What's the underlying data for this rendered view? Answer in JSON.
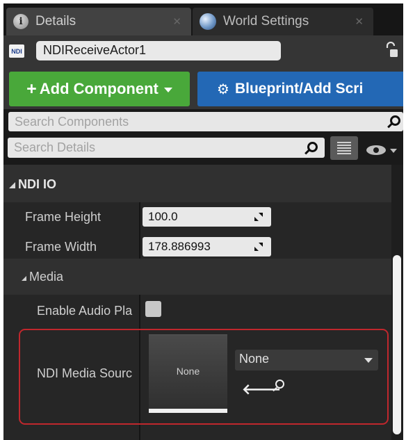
{
  "tabs": [
    {
      "label": "Details",
      "icon": "info-icon",
      "active": true
    },
    {
      "label": "World Settings",
      "icon": "globe-icon",
      "active": false
    }
  ],
  "actor": {
    "name": "NDIReceiveActor1",
    "logo_text": "NDI"
  },
  "buttons": {
    "add_component": "Add Component",
    "blueprint": "Blueprint/Add Scri"
  },
  "search": {
    "components_placeholder": "Search Components",
    "details_placeholder": "Search Details"
  },
  "category": {
    "label": "NDI IO"
  },
  "properties": {
    "frame_height": {
      "label": "Frame Height",
      "value": "100.0"
    },
    "frame_width": {
      "label": "Frame Width",
      "value": "178.886993"
    }
  },
  "media": {
    "label": "Media",
    "enable_audio": {
      "label": "Enable Audio Pla",
      "checked": false
    },
    "source": {
      "label": "NDI Media Sourc",
      "thumbnail_text": "None",
      "selected": "None"
    }
  },
  "colors": {
    "add_green": "#49a83a",
    "blueprint_blue": "#2368b5",
    "highlight_red": "#c0272d"
  }
}
